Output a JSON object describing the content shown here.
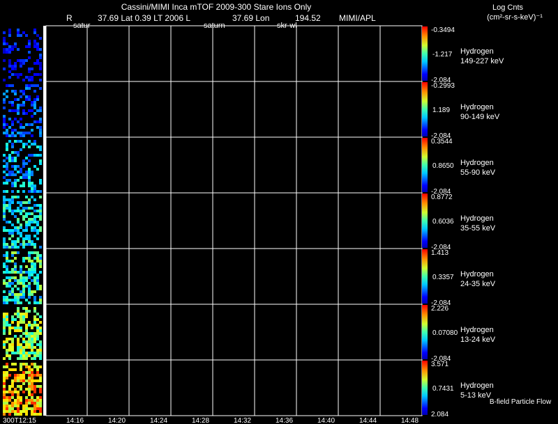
{
  "header": {
    "title": "Cassini/MIMI Inca mTOF  2009-300   Stare    Ions Only",
    "r_label": "R",
    "lat_text": "37.69 Lat 0.39 LT 2006 L",
    "lon_text": "37.69 Lon",
    "val_text": "194.52",
    "credit": "MIMI/APL",
    "overlay_left": "satur",
    "overlay_mid": "saturn",
    "overlay_right": "skr-wl",
    "units_line1": "Log Cnts",
    "units_line2": "(cm²-sr-s-keV)⁻¹",
    "footer_note": "B-field Particle Flow"
  },
  "colors": {
    "background": "#000000",
    "grid": "#ffffff",
    "text": "#ffffff"
  },
  "chart_data": {
    "type": "heatmap",
    "description_axis": "time (UT)",
    "x_tick_labels": [
      "300T12:15",
      "14:16",
      "14:20",
      "14:24",
      "14:28",
      "14:32",
      "14:36",
      "14:40",
      "14:44",
      "14:48"
    ],
    "panels": [
      {
        "species": "Hydrogen",
        "energy": "149-227 keV",
        "cbar_max": "-0.3494",
        "cbar_mid": "-1.217",
        "cbar_min": "-2.084"
      },
      {
        "species": "Hydrogen",
        "energy": "90-149 keV",
        "cbar_max": "-0.2993",
        "cbar_mid": "1.189",
        "cbar_min": "-2.084"
      },
      {
        "species": "Hydrogen",
        "energy": "55-90 keV",
        "cbar_max": "0.3544",
        "cbar_mid": "0.8650",
        "cbar_min": "-2.084"
      },
      {
        "species": "Hydrogen",
        "energy": "35-55 keV",
        "cbar_max": "0.8772",
        "cbar_mid": "0.6036",
        "cbar_min": "-2.084"
      },
      {
        "species": "Hydrogen",
        "energy": "24-35 keV",
        "cbar_max": "1.413",
        "cbar_mid": "0.3357",
        "cbar_min": "-2.084"
      },
      {
        "species": "Hydrogen",
        "energy": "13-24 keV",
        "cbar_max": "2.226",
        "cbar_mid": "0.07080",
        "cbar_min": "-2.084"
      },
      {
        "species": "Hydrogen",
        "energy": "5-13 keV",
        "cbar_max": "3.571",
        "cbar_mid": "0.7431",
        "cbar_min": "2.084"
      }
    ]
  }
}
